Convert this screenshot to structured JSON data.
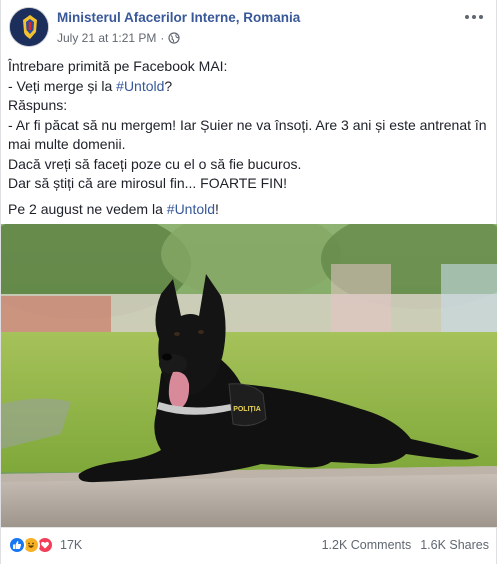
{
  "post": {
    "page_name": "Ministerul Afacerilor Interne, Romania",
    "timestamp": "July 21 at 1:21 PM",
    "separator": "·",
    "text": {
      "line1": "Întrebare primită pe Facebook MAI:",
      "line2_prefix": "- Veți merge și la ",
      "hashtag_untold": "#Untold",
      "line2_suffix": "?",
      "line3": "Răspuns:",
      "line4": "- Ar fi păcat să nu mergem! Iar Șuier ne va însoți. Are 3 ani și este antrenat în mai multe domenii.",
      "line5": "Dacă vreți să faceți poze cu el o să fie bucuros.",
      "line6": "Dar să știți că are mirosul fin... FOARTE FIN!",
      "line7_prefix": "Pe 2 august ne vedem la ",
      "line7_hashtag": "#Untold",
      "line7_suffix": "!"
    },
    "photo": {
      "collar_text": "POLIȚIA"
    },
    "stats": {
      "reactions": "17K",
      "comments": "1.2K Comments",
      "shares": "1.6K Shares"
    },
    "colors": {
      "link": "#385898",
      "like": "#1877f2",
      "haha": "#f7b125",
      "love": "#f33e58"
    },
    "icons": [
      "globe-icon",
      "more-options-icon",
      "like-reaction-icon",
      "haha-reaction-icon",
      "love-reaction-icon",
      "coat-of-arms-icon"
    ]
  }
}
